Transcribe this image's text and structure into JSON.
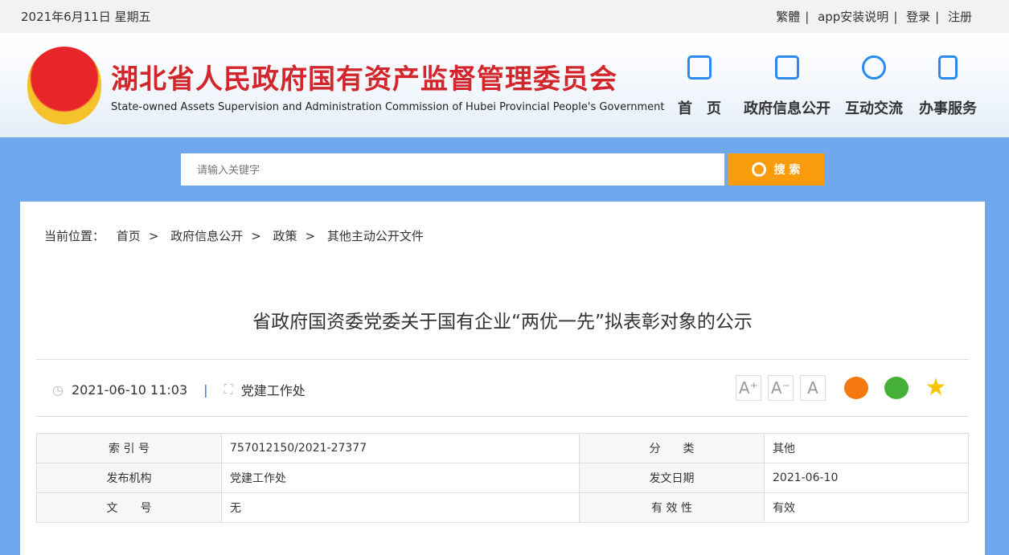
{
  "topbar": {
    "date": "2021年6月11日 星期五",
    "links": [
      "繁體",
      "app安装说明",
      "登录",
      "注册"
    ]
  },
  "header": {
    "title": "湖北省人民政府国有资产监督管理委员会",
    "subtitle": "State-owned Assets Supervision and Administration Commission of Hubei Provincial People's Government",
    "nav": [
      {
        "label": "首　页",
        "icon": "home-icon"
      },
      {
        "label": "政府信息公开",
        "icon": "document-icon"
      },
      {
        "label": "互动交流",
        "icon": "chat-icon"
      },
      {
        "label": "办事服务",
        "icon": "bookmark-icon"
      }
    ]
  },
  "search": {
    "placeholder": "请输入关键字",
    "button": "搜 索"
  },
  "breadcrumb": {
    "label": "当前位置：",
    "items": [
      "首页",
      "政府信息公开",
      "政策",
      "其他主动公开文件"
    ],
    "sep": ">"
  },
  "article": {
    "title": "省政府国资委党委关于国有企业“两优一先”拟表彰对象的公示",
    "datetime": "2021-06-10 11:03",
    "sep": "|",
    "department": "党建工作处",
    "font_buttons": [
      "A⁺",
      "A⁻",
      "A"
    ]
  },
  "info_table": [
    [
      "索 引 号",
      "757012150/2021-27377",
      "分　　类",
      "其他"
    ],
    [
      "发布机构",
      "党建工作处",
      "发文日期",
      "2021-06-10"
    ],
    [
      "文　　号",
      "无",
      "有 效 性",
      "有效"
    ]
  ]
}
